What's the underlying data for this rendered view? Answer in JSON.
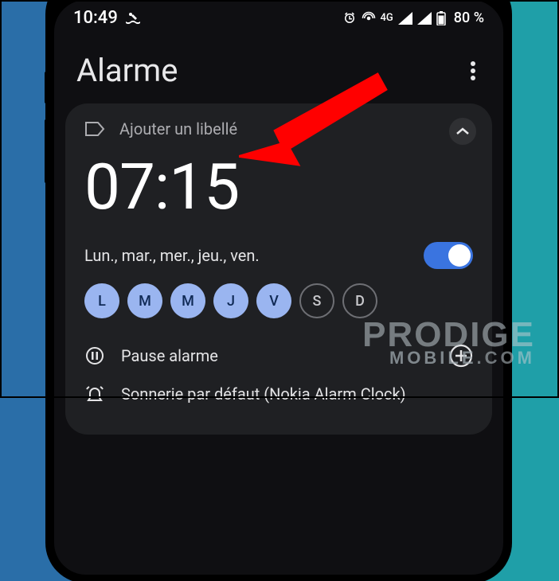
{
  "status": {
    "time": "10:49",
    "network_label": "4G",
    "battery_pct": "80 %"
  },
  "header": {
    "title": "Alarme"
  },
  "card": {
    "add_label": "Ajouter un libellé",
    "time": "07:15",
    "days_text": "Lun., mar., mer., jeu., ven.",
    "days": [
      {
        "letter": "L",
        "on": true
      },
      {
        "letter": "M",
        "on": true
      },
      {
        "letter": "M",
        "on": true
      },
      {
        "letter": "J",
        "on": true
      },
      {
        "letter": "V",
        "on": true
      },
      {
        "letter": "S",
        "on": false
      },
      {
        "letter": "D",
        "on": false
      }
    ],
    "pause_label": "Pause alarme",
    "ringtone_label": "Sonnerie par défaut (Nokia Alarm Clock)"
  },
  "watermark": {
    "line1": "PRODIGE",
    "line2_a": "MOBILE",
    "line2_b": ".COM"
  }
}
